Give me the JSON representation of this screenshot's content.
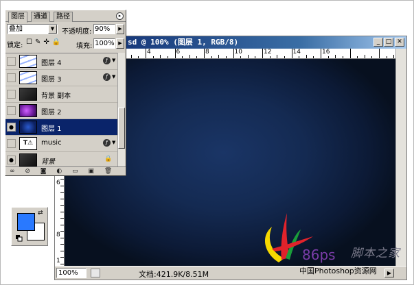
{
  "document": {
    "title": "sd @ 100% (图层 1, RGB/8)",
    "ruler_h": [
      "4",
      "6",
      "8",
      "10",
      "12",
      "14",
      "16"
    ],
    "ruler_v": [
      "6",
      "8",
      "1"
    ],
    "zoom": "100%",
    "doc_size": "文档:421.9K/8.51M",
    "canvas_colors": {
      "center": "#1a3566",
      "edge": "#07101f"
    }
  },
  "layers_panel": {
    "tabs": [
      "图层",
      "通道",
      "路径"
    ],
    "blend_mode": "叠加",
    "opacity_label": "不透明度:",
    "opacity_value": "90%",
    "lock_label": "锁定:",
    "fill_label": "填充:",
    "fill_value": "100%",
    "layers": [
      {
        "name": "图层 4",
        "visible": false,
        "thumb": "wave",
        "has_fx": true,
        "selected": false
      },
      {
        "name": "图层 3",
        "visible": false,
        "thumb": "wave",
        "has_fx": true,
        "selected": false
      },
      {
        "name": "背景 副本",
        "visible": false,
        "thumb": "dark",
        "has_fx": false,
        "selected": false
      },
      {
        "name": "图层 2",
        "visible": false,
        "thumb": "purple",
        "has_fx": false,
        "selected": false
      },
      {
        "name": "图层 1",
        "visible": true,
        "thumb": "blue",
        "has_fx": false,
        "selected": true
      },
      {
        "name": "music",
        "visible": false,
        "thumb": "text",
        "has_fx": true,
        "selected": false
      },
      {
        "name": "背景",
        "visible": true,
        "thumb": "dark",
        "has_fx": false,
        "locked": true,
        "selected": false
      }
    ]
  },
  "swatches": {
    "foreground": "#2979ff",
    "background": "#ffffff"
  },
  "watermark": {
    "logo_text": "86ps",
    "site_cn": "中国Photoshop资源网",
    "brand": "脚本之家"
  }
}
